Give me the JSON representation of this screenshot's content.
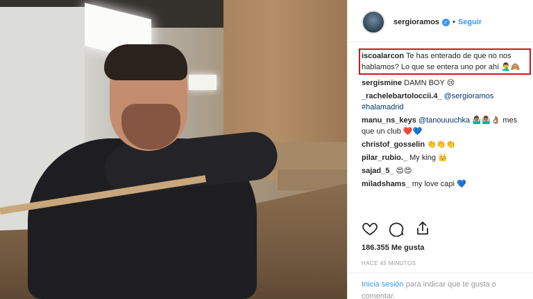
{
  "post": {
    "username": "sergioramos",
    "verified_symbol": "✓",
    "separator": "•",
    "follow_label": "Seguir"
  },
  "highlighted_comment": {
    "user": "iscoalarcon",
    "text": "Te has enterado de que no nos hablamos? Lo que se entera uno por ahí",
    "emoji": "🤦‍♂️🙈"
  },
  "comments": [
    {
      "user": "sergismine",
      "text": "DAMN BOY 😢"
    },
    {
      "user": "_rachelebartoloccii.4_",
      "mention": "@sergioramos",
      "text": "#halamadrid"
    },
    {
      "user": "manu_ns_keys",
      "mention": "@tanouuuchka",
      "text": "🤷🏽‍♂️🤷🏽‍♂️👌🏽 mes que un club ❤️💙"
    },
    {
      "user": "christof_gosselin",
      "text": "👏👏👏"
    },
    {
      "user": "pilar_rubio._",
      "text": "My king 👑"
    },
    {
      "user": "sajad_5_",
      "text": "😍😍"
    },
    {
      "user": "miladshams_",
      "text": "my love capi 💙"
    }
  ],
  "likes_text": "186.355 Me gusta",
  "time_ago": "HACE 45 MINUTOS",
  "login": {
    "link": "Inicia sesión",
    "rest": "para indicar que te gusta o comentar."
  },
  "icons": [
    "heart-icon",
    "comment-icon",
    "share-icon"
  ],
  "colors": {
    "link": "#3897f0",
    "highlight_border": "#d0121b"
  }
}
